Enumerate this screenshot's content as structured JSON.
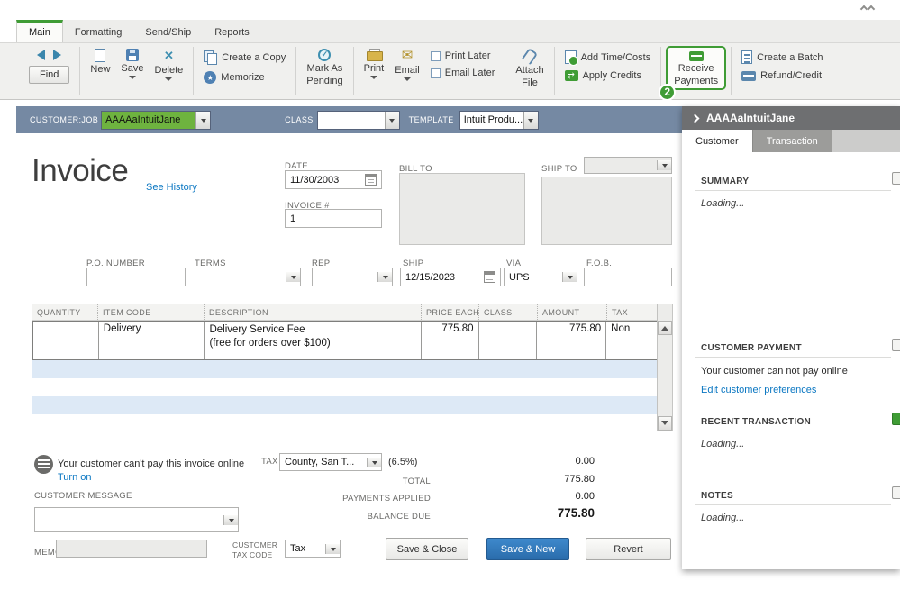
{
  "ribbon_tabs": [
    {
      "label": "Main",
      "active": true
    },
    {
      "label": "Formatting",
      "active": false
    },
    {
      "label": "Send/Ship",
      "active": false
    },
    {
      "label": "Reports",
      "active": false
    }
  ],
  "toolbar": {
    "find_label": "Find",
    "new_label": "New",
    "save_label": "Save",
    "delete_label": "Delete",
    "create_copy_label": "Create a Copy",
    "memorize_label": "Memorize",
    "mark_pending_label_1": "Mark As",
    "mark_pending_label_2": "Pending",
    "print_label": "Print",
    "email_label": "Email",
    "print_later_label": "Print Later",
    "email_later_label": "Email Later",
    "attach_label_1": "Attach",
    "attach_label_2": "File",
    "add_time_costs_label": "Add Time/Costs",
    "apply_credits_label": "Apply Credits",
    "receive_payments_label_1": "Receive",
    "receive_payments_label_2": "Payments",
    "receive_payments_badge": "2",
    "create_batch_label": "Create a Batch",
    "refund_credit_label": "Refund/Credit"
  },
  "customer_bar": {
    "customer_job_label": "CUSTOMER:JOB",
    "customer_value": "AAAAaIntuitJane",
    "class_label": "CLASS",
    "class_value": "",
    "template_label": "TEMPLATE",
    "template_value": "Intuit Produ..."
  },
  "invoice_header": {
    "title": "Invoice",
    "see_history_link": "See History",
    "date_label": "DATE",
    "date_value": "11/30/2003",
    "invoice_no_label": "INVOICE #",
    "invoice_no_value": "1",
    "bill_to_label": "BILL TO",
    "ship_to_label": "SHIP TO"
  },
  "detail_fields": {
    "po_number_label": "P.O. NUMBER",
    "po_number_value": "",
    "terms_label": "TERMS",
    "terms_value": "",
    "rep_label": "REP",
    "rep_value": "",
    "ship_label": "SHIP",
    "ship_value": "12/15/2023",
    "via_label": "VIA",
    "via_value": "UPS",
    "fob_label": "F.O.B.",
    "fob_value": ""
  },
  "items_table": {
    "columns": [
      "QUANTITY",
      "ITEM CODE",
      "DESCRIPTION",
      "PRICE EACH",
      "CLASS",
      "AMOUNT",
      "TAX"
    ],
    "rows": [
      {
        "quantity": "",
        "item_code": "Delivery",
        "description": "Delivery Service Fee\n(free for orders over $100)",
        "price_each": "775.80",
        "class": "",
        "amount": "775.80",
        "tax": "Non"
      }
    ]
  },
  "totals": {
    "online_payment_notice": "Your customer can't pay this invoice online",
    "turn_on_link": "Turn on",
    "tax_label": "TAX",
    "tax_value": "County, San T...",
    "tax_rate": "(6.5%)",
    "tax_amount": "0.00",
    "total_label": "TOTAL",
    "total_value": "775.80",
    "payments_applied_label": "PAYMENTS APPLIED",
    "payments_applied_value": "0.00",
    "balance_due_label": "BALANCE DUE",
    "balance_due_value": "775.80"
  },
  "footer": {
    "customer_message_label": "CUSTOMER MESSAGE",
    "customer_message_value": "",
    "memo_label": "MEMO",
    "memo_value": "",
    "customer_tax_code_label_1": "CUSTOMER",
    "customer_tax_code_label_2": "TAX CODE",
    "customer_tax_code_value": "Tax",
    "save_close_button": "Save & Close",
    "save_new_button": "Save & New",
    "revert_button": "Revert"
  },
  "right_panel": {
    "name": "AAAAaIntuitJane",
    "tabs": [
      {
        "label": "Customer",
        "active": true
      },
      {
        "label": "Transaction",
        "active": false
      }
    ],
    "summary_heading": "SUMMARY",
    "summary_loading": "Loading...",
    "customer_payment_heading": "CUSTOMER PAYMENT",
    "customer_payment_notice": "Your customer can not pay online",
    "edit_preferences_link": "Edit customer preferences",
    "recent_transaction_heading": "RECENT TRANSACTION",
    "recent_transaction_loading": "Loading...",
    "notes_heading": "NOTES",
    "notes_loading": "Loading..."
  },
  "colors": {
    "accent_green": "#3f9c35",
    "link_blue": "#0b77c2",
    "slate_bar": "#7589a3",
    "primary_button_blue": "#2a6cab"
  }
}
